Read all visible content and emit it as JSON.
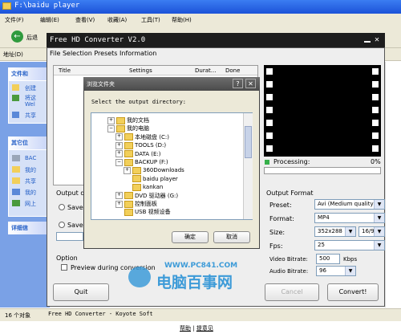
{
  "explorer": {
    "title": "F:\\baidu player",
    "menus": [
      "文件(F)",
      "编辑(E)",
      "查看(V)",
      "收藏(A)",
      "工具(T)",
      "帮助(H)"
    ],
    "back_label": "后退",
    "address_label": "地址(D)",
    "tasks": {
      "file_tasks_title": "文件和",
      "file_items": [
        "创建",
        "将这",
        "Wel",
        "共享"
      ],
      "other_title": "其它位",
      "other_items": [
        "BAC",
        "我的",
        "共享",
        "我的",
        "网上"
      ],
      "details_title": "详细信"
    },
    "status": "16 个对象",
    "bottom_links": [
      "帮助",
      "提意见"
    ],
    "bottom_sep": "|"
  },
  "converter": {
    "title": "Free HD Converter V2.0",
    "menu": [
      "File",
      "Selection",
      "Presets",
      "Information"
    ],
    "table_headers": [
      "Title",
      "Settings",
      "Durat...",
      "Done"
    ],
    "output_dir_label": "Output dir",
    "save_here_1": "Save h",
    "save_here_2": "Save h",
    "option_label": "Option",
    "preview_label": "Preview during conversion",
    "quit": "Quit",
    "cancel": "Cancel",
    "convert": "Convert!",
    "processing_label": "Processing:",
    "processing_value": "0%",
    "progress": 0,
    "output_format_title": "Output Format",
    "fields": {
      "preset_label": "Preset:",
      "preset_value": "Avi (Medium quality)",
      "format_label": "Format:",
      "format_value": "MP4",
      "size_label": "Size:",
      "size_value": "352x288",
      "aspect_value": "16/9",
      "fps_label": "Fps:",
      "fps_value": "25",
      "vbit_label": "Video Bitrate:",
      "vbit_value": "500",
      "vbit_unit": "Kbps",
      "abit_label": "Audio Bitrate:",
      "abit_value": "96"
    },
    "status_bar": "Free HD Converter - Koyote Soft"
  },
  "dialog": {
    "title": "浏览文件夹",
    "help": "?",
    "close": "✕",
    "instruction": "Select the output directory:",
    "tree": [
      {
        "label": "我的文档",
        "exp": "+",
        "indent": 0
      },
      {
        "label": "我的电脑",
        "exp": "−",
        "indent": 0
      },
      {
        "label": "本地磁盘 (C:)",
        "exp": "+",
        "indent": 1
      },
      {
        "label": "TOOLS (D:)",
        "exp": "+",
        "indent": 1
      },
      {
        "label": "DATA (E:)",
        "exp": "+",
        "indent": 1
      },
      {
        "label": "BACKUP (F:)",
        "exp": "−",
        "indent": 1
      },
      {
        "label": "360Downloads",
        "exp": "+",
        "indent": 2
      },
      {
        "label": "baidu player",
        "exp": "",
        "indent": 2
      },
      {
        "label": "kankan",
        "exp": "",
        "indent": 2
      },
      {
        "label": "DVD 驱动器 (G:)",
        "exp": "+",
        "indent": 1
      },
      {
        "label": "控制面板",
        "exp": "+",
        "indent": 1
      },
      {
        "label": "USB 视频设备",
        "exp": "",
        "indent": 1
      }
    ],
    "ok": "确定",
    "cancel": "取消"
  },
  "watermark": {
    "url": "WWW.PC841.COM",
    "brand": "电脑百事网"
  },
  "colors": {
    "xp_blue": "#1c52d8",
    "task_pane": "#7aa1e6",
    "converter_title": "#1d1d1d",
    "progress_green": "#36b04a",
    "watermark": "#3d9bd8"
  }
}
